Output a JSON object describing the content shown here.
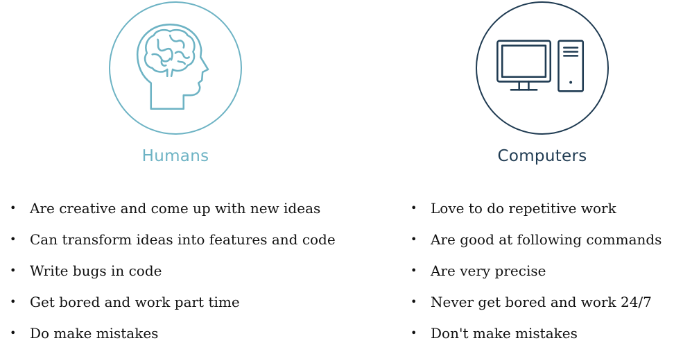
{
  "colors": {
    "humans_accent": "#6db3c4",
    "computers_accent": "#1f3b52",
    "text": "#111111",
    "background": "#ffffff"
  },
  "humans": {
    "icon": "human-head-brain-icon",
    "title": "Humans",
    "items": [
      "Are creative and come up with new ideas",
      "Can transform ideas into features and code",
      "Write bugs in code",
      "Get bored and work part time",
      "Do make mistakes"
    ]
  },
  "computers": {
    "icon": "desktop-computer-icon",
    "title": "Computers",
    "items": [
      "Love to do repetitive work",
      "Are good at following commands",
      "Are very precise",
      "Never get bored and work 24/7",
      "Don't make mistakes"
    ]
  }
}
